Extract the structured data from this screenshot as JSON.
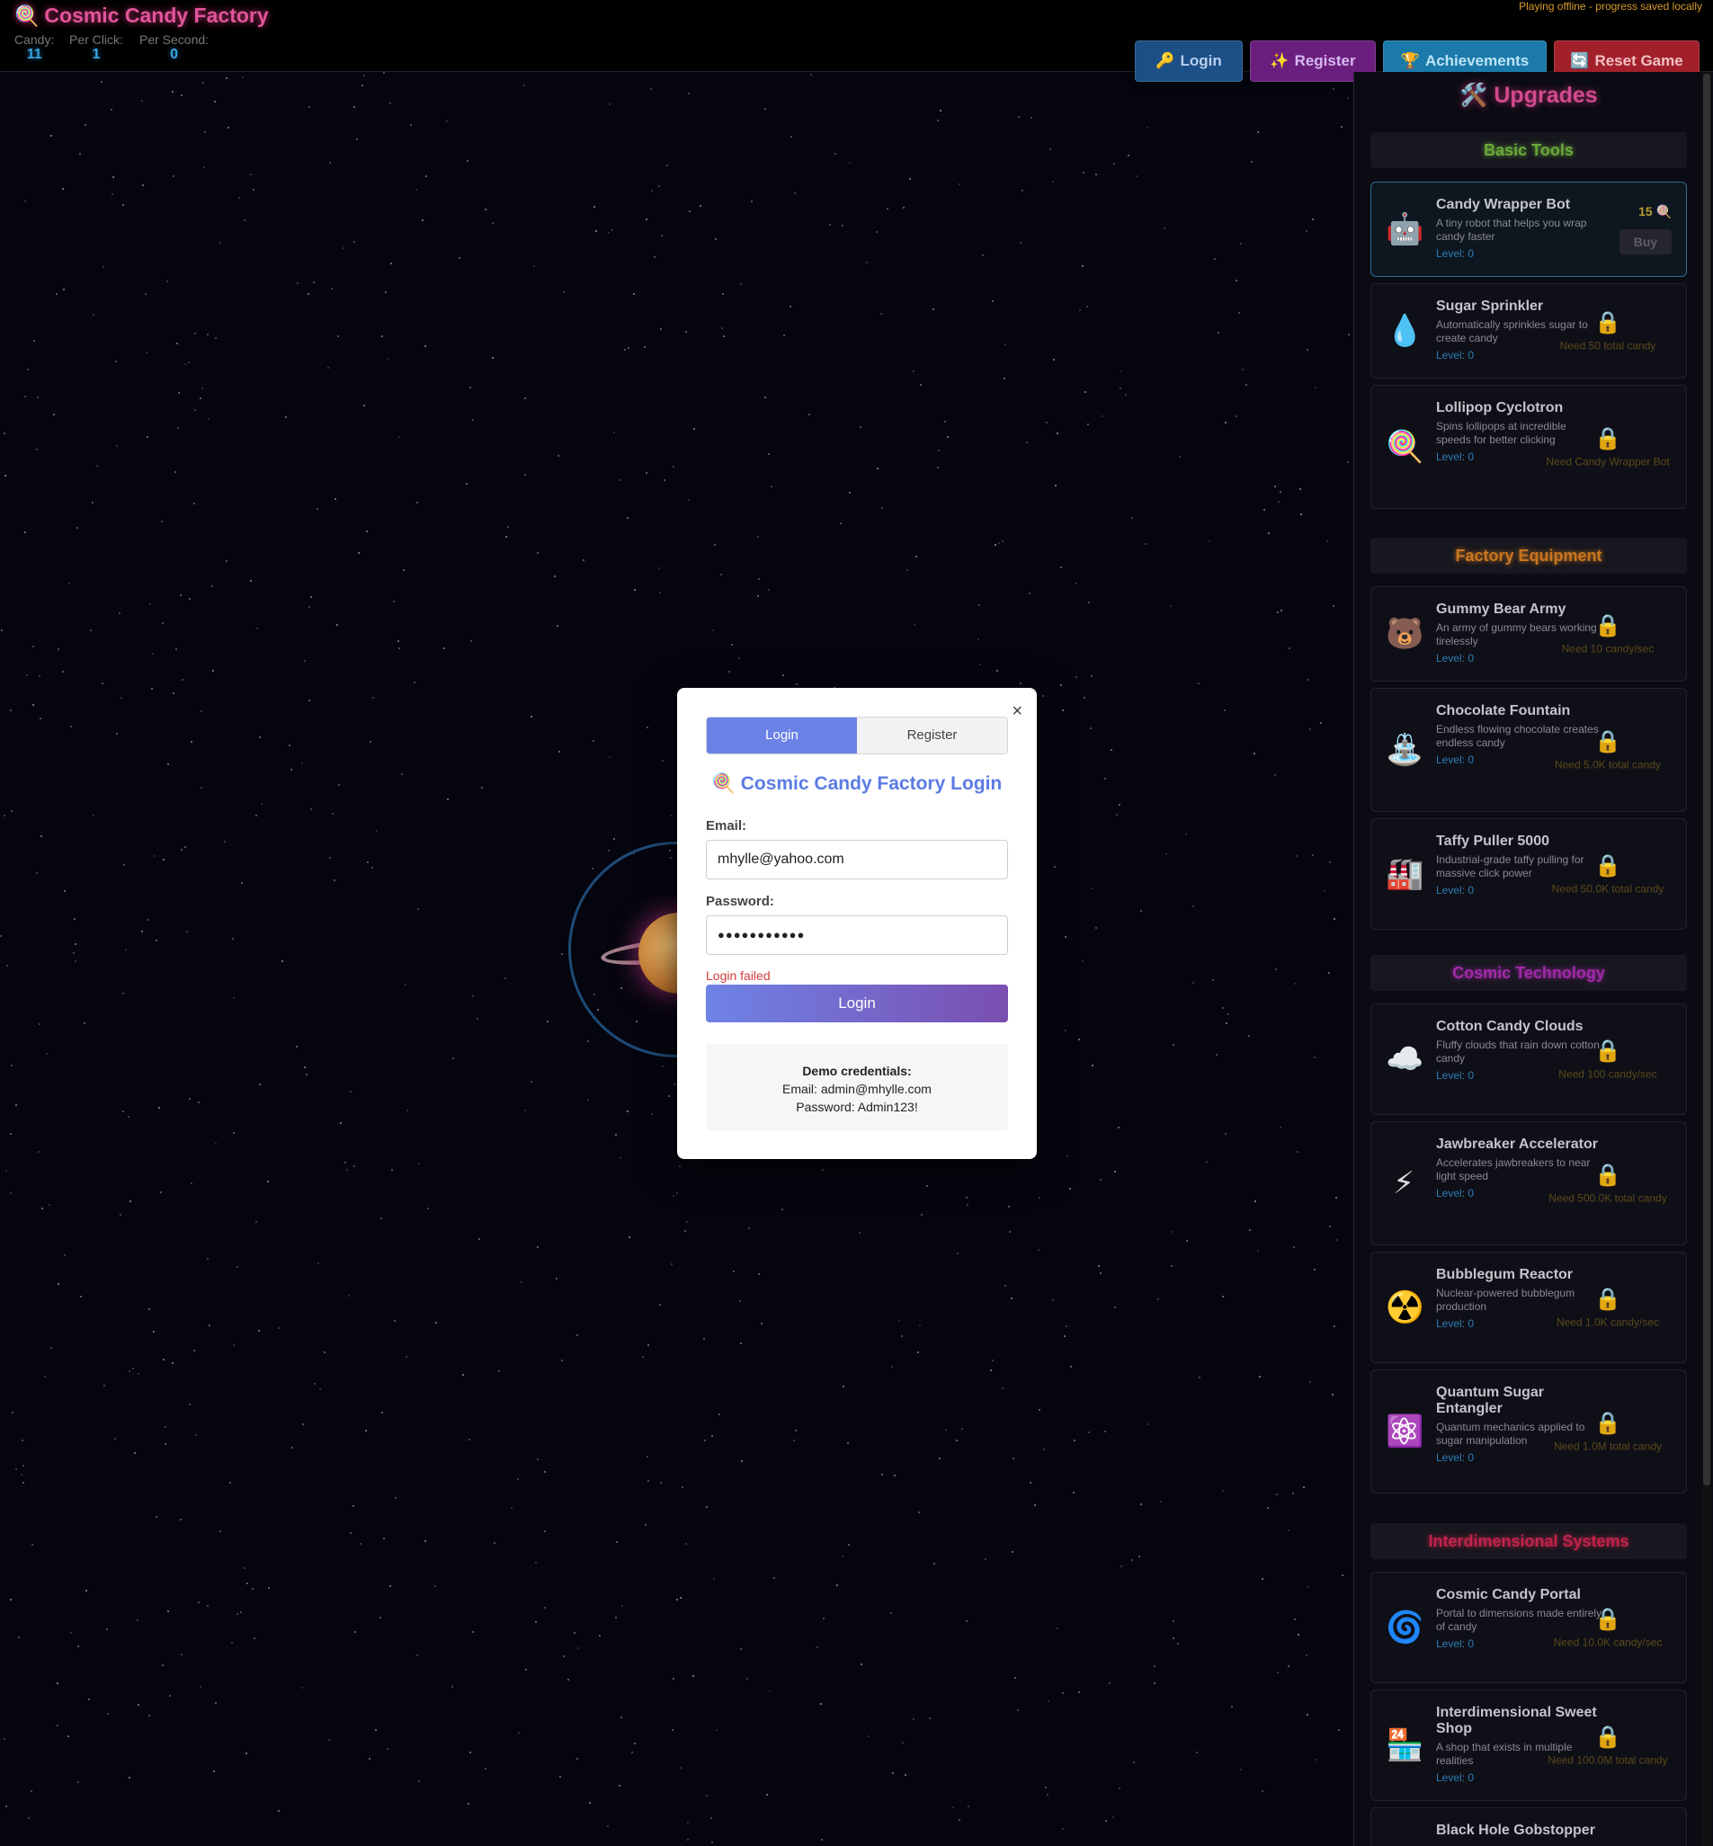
{
  "header": {
    "title_icon": "🍭",
    "title": "Cosmic Candy Factory",
    "stats": [
      {
        "label": "Candy:",
        "value": "11"
      },
      {
        "label": "Per Click:",
        "value": "1"
      },
      {
        "label": "Per Second:",
        "value": "0"
      }
    ],
    "offline_note": "Playing offline - progress saved locally",
    "buttons": {
      "login": {
        "icon": "🔑",
        "label": "Login"
      },
      "register": {
        "icon": "✨",
        "label": "Register"
      },
      "achievements": {
        "icon": "🏆",
        "label": "Achievements"
      },
      "reset": {
        "icon": "🔄",
        "label": "Reset Game"
      }
    }
  },
  "upgrades": {
    "title": "🛠️ Upgrades",
    "categories": [
      {
        "name": "Basic Tools",
        "color": "#6aa83a"
      },
      {
        "name": "Factory Equipment",
        "color": "#c9761f"
      },
      {
        "name": "Cosmic Technology",
        "color": "#a02aa8"
      },
      {
        "name": "Interdimensional Systems",
        "color": "#c0244a"
      }
    ],
    "items": [
      {
        "icon": "🤖",
        "name": "Candy Wrapper Bot",
        "desc": "A tiny robot that helps you wrap candy faster",
        "level": "Level: 0",
        "cost": "15 🍭",
        "buy": "Buy",
        "locked": false
      },
      {
        "icon": "💧",
        "name": "Sugar Sprinkler",
        "desc": "Automatically sprinkles sugar to create candy",
        "level": "Level: 0",
        "need": "Need 50 total candy",
        "locked": true
      },
      {
        "icon": "🍭",
        "name": "Lollipop Cyclotron",
        "desc": "Spins lollipops at incredible speeds for better clicking",
        "level": "Level: 0",
        "need": "Need Candy Wrapper Bot",
        "locked": true
      },
      {
        "icon": "🐻",
        "name": "Gummy Bear Army",
        "desc": "An army of gummy bears working tirelessly",
        "level": "Level: 0",
        "need": "Need 10 candy/sec",
        "locked": true
      },
      {
        "icon": "⛲",
        "name": "Chocolate Fountain",
        "desc": "Endless flowing chocolate creates endless candy",
        "level": "Level: 0",
        "need": "Need 5.0K total candy",
        "locked": true
      },
      {
        "icon": "🏭",
        "name": "Taffy Puller 5000",
        "desc": "Industrial-grade taffy pulling for massive click power",
        "level": "Level: 0",
        "need": "Need 50.0K total candy",
        "locked": true
      },
      {
        "icon": "☁️",
        "name": "Cotton Candy Clouds",
        "desc": "Fluffy clouds that rain down cotton candy",
        "level": "Level: 0",
        "need": "Need 100 candy/sec",
        "locked": true
      },
      {
        "icon": "⚡",
        "name": "Jawbreaker Accelerator",
        "desc": "Accelerates jawbreakers to near light speed",
        "level": "Level: 0",
        "need": "Need 500.0K total candy",
        "locked": true
      },
      {
        "icon": "☢️",
        "name": "Bubblegum Reactor",
        "desc": "Nuclear-powered bubblegum production",
        "level": "Level: 0",
        "need": "Need 1.0K candy/sec",
        "locked": true
      },
      {
        "icon": "⚛️",
        "name": "Quantum Sugar Entangler",
        "desc": "Quantum mechanics applied to sugar manipulation",
        "level": "Level: 0",
        "need": "Need 1.0M total candy",
        "locked": true
      },
      {
        "icon": "🌀",
        "name": "Cosmic Candy Portal",
        "desc": "Portal to dimensions made entirely of candy",
        "level": "Level: 0",
        "need": "Need 10.0K candy/sec",
        "locked": true
      },
      {
        "icon": "🏪",
        "name": "Interdimensional Sweet Shop",
        "desc": "A shop that exists in multiple realities",
        "level": "Level: 0",
        "need": "Need 100.0M total candy",
        "locked": true
      },
      {
        "icon": "",
        "name": "Black Hole Gobstopper",
        "desc": "",
        "level": "",
        "need": "",
        "locked": true
      }
    ],
    "lock_icon": "🔒"
  },
  "modal": {
    "close": "×",
    "tabs": [
      "Login",
      "Register"
    ],
    "title": "🍭 Cosmic Candy Factory Login",
    "email_label": "Email:",
    "email_value": "mhylle@yahoo.com",
    "password_label": "Password:",
    "password_value": "●●●●●●●●●●●",
    "error": "Login failed",
    "submit": "Login",
    "demo_heading": "Demo credentials:",
    "demo_email": "Email: admin@mhylle.com",
    "demo_password": "Password: Admin123!"
  }
}
